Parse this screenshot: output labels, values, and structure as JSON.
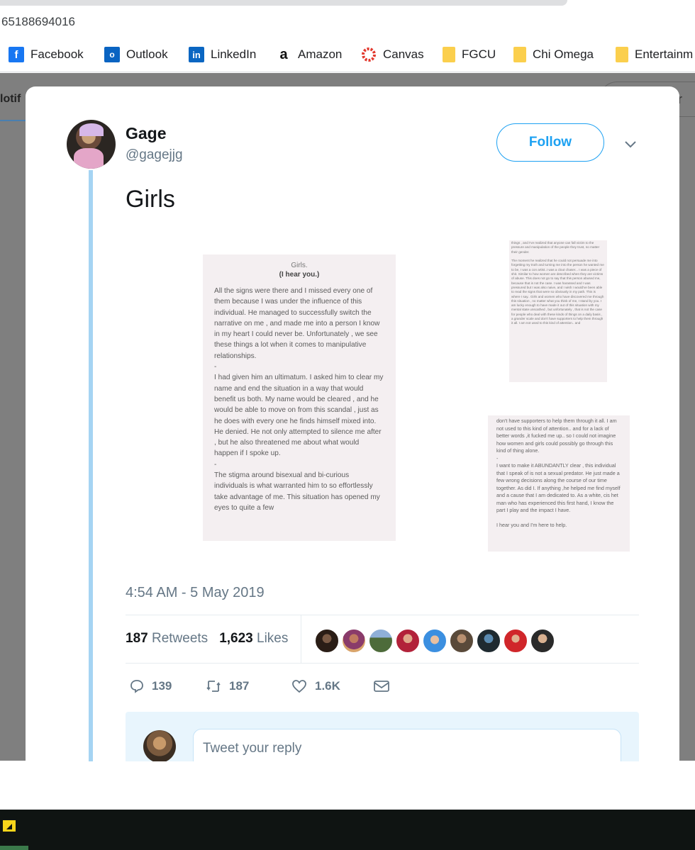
{
  "browser": {
    "url_text": "65188694016",
    "bookmarks": [
      {
        "label": "Facebook",
        "icon": "facebook-icon"
      },
      {
        "label": "Outlook",
        "icon": "outlook-icon"
      },
      {
        "label": "LinkedIn",
        "icon": "linkedin-icon"
      },
      {
        "label": "Amazon",
        "icon": "amazon-icon"
      },
      {
        "label": "Canvas",
        "icon": "canvas-icon"
      },
      {
        "label": "FGCU",
        "icon": "folder-icon"
      },
      {
        "label": "Chi Omega",
        "icon": "folder-icon"
      },
      {
        "label": "Entertainm",
        "icon": "folder-icon"
      }
    ]
  },
  "background": {
    "tab_fragment": "lotif",
    "right_fragment": "r"
  },
  "tweet": {
    "author_name": "Gage",
    "author_handle": "@gagejjg",
    "follow_label": "Follow",
    "text": "Girls",
    "timestamp": "4:54 AM - 5 May 2019",
    "retweets_count": "187",
    "retweets_label": "Retweets",
    "likes_count": "1,623",
    "likes_label": "Likes",
    "actions": {
      "replies": "139",
      "retweets": "187",
      "likes": "1.6K"
    },
    "reply_placeholder": "Tweet your reply"
  },
  "images": {
    "a_title": "Girls.",
    "a_subtitle": "(I hear you.)",
    "a_body": "All the signs were there and I missed every one of them because I was under the influence of this individual. He managed to successfully switch the narrative on me , and made me into a person I know in my heart I could never be. Unfortunately , we see these things a lot when it comes to manipulative relationships.\n-\nI had given him an ultimatum. I asked him to clear my name and end the situation in a way that would benefit us both. My name would be cleared , and he would be able to move on from this scandal , just as he does with every one he finds himself mixed into. He denied. He not only attempted to silence me after , but he also threatened me about what would happen if I spoke up.\n-\nThe stigma around bisexual and bi-curious individuals is what warranted him to so effortlessly take advantage of me. This situation has opened my eyes to quite a few",
    "b_body": "things , and I've realized that anyone can fall victim to the pressure and manipulation of the people they trust, no matter their gender.\n\nThe moment he realized that he could not persuade me into forgetting my truth and turning me into the person he wanted me to be, I was a con artist..I was a clout chaser... I was a piece of shit. Similar to how women are described when they are victims of abuse. This does not go to say that this person abused me, because that is not the case. I was harassed and I was pressured but I was also naive, and I wish I would've been able to read the signs that were so obviously in my path. This is where I say.. Girls and women who have discovered me through this situation , no matter what you think of me, I stand by you. I am lucky enough to have made it out of this situation with my mental state unscathed , but unfortunately , that is not the case for people who deal with these kinds of things on a daily basis , a grander scale and don't have supporters to help them through it all. I am not used to this kind of attention.. and",
    "c_body": "don't have supporters to help them through it all. I am not used to this kind of attention.. and for a lack of better words ,it fucked me up.. so I could not imagine how women and girls could possibly go through this kind of thing alone.\n-\nI want to make it ABUNDANTLY clear , this individual that I speak of is not a sexual predator. He just made a few wrong decisions along the course of our time together. As did I. If anything ,he helped me find myself and a cause that I am dedicated to. As a white, cis het man who has experienced this first hand, I know the part I play and the impact I have.\n\nI hear you and I'm here to help."
  },
  "colors": {
    "twitter_blue": "#1da1f2",
    "thread_line": "#a5d4f3",
    "muted_text": "#657786",
    "overlay": "#7f7f7f",
    "taskbar": "#0f1412"
  }
}
